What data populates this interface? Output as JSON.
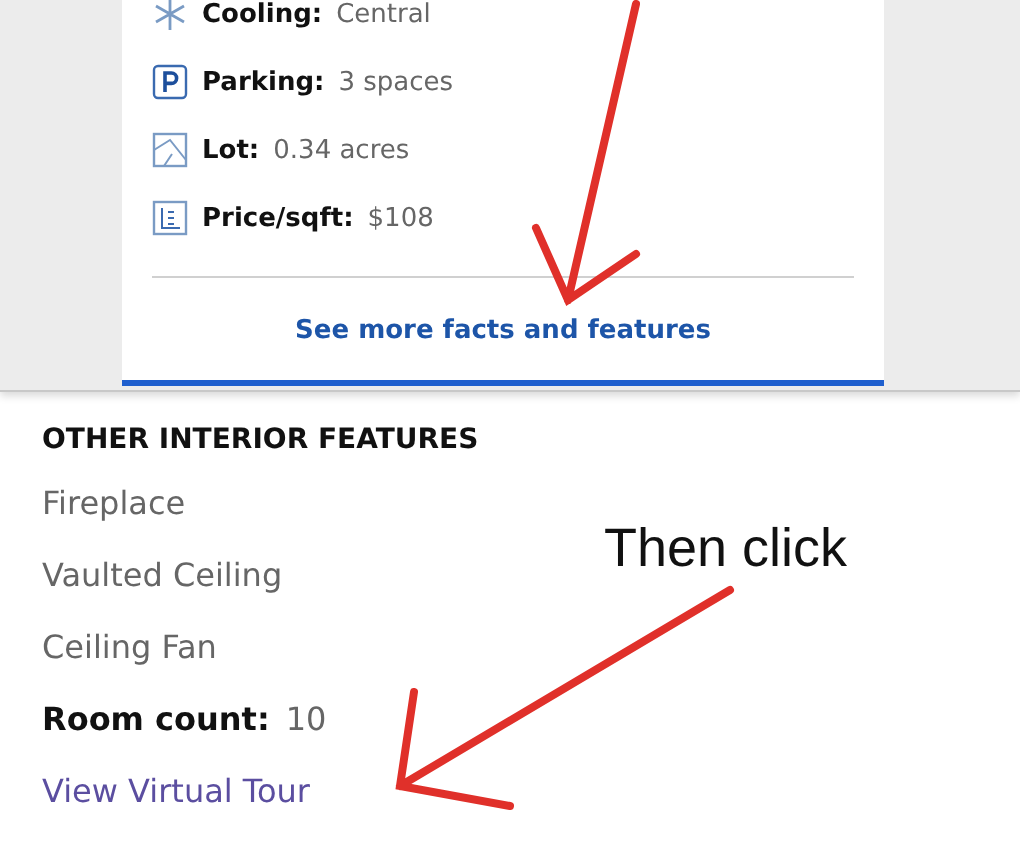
{
  "facts": [
    {
      "kind": "cooling",
      "label": "Cooling:",
      "value": "Central"
    },
    {
      "kind": "parking",
      "label": "Parking:",
      "value": "3 spaces"
    },
    {
      "kind": "lot",
      "label": "Lot:",
      "value": "0.34 acres"
    },
    {
      "kind": "price",
      "label": "Price/sqft:",
      "value": "$108"
    }
  ],
  "more_link": "See more facts and features",
  "interior": {
    "heading": "OTHER INTERIOR FEATURES",
    "items": [
      "Fireplace",
      "Vaulted Ceiling",
      "Ceiling Fan"
    ],
    "room_count": {
      "label": "Room count:",
      "value": "10"
    },
    "tour_link": "View Virtual Tour"
  },
  "annotations": [
    {
      "text": "Then click"
    }
  ]
}
